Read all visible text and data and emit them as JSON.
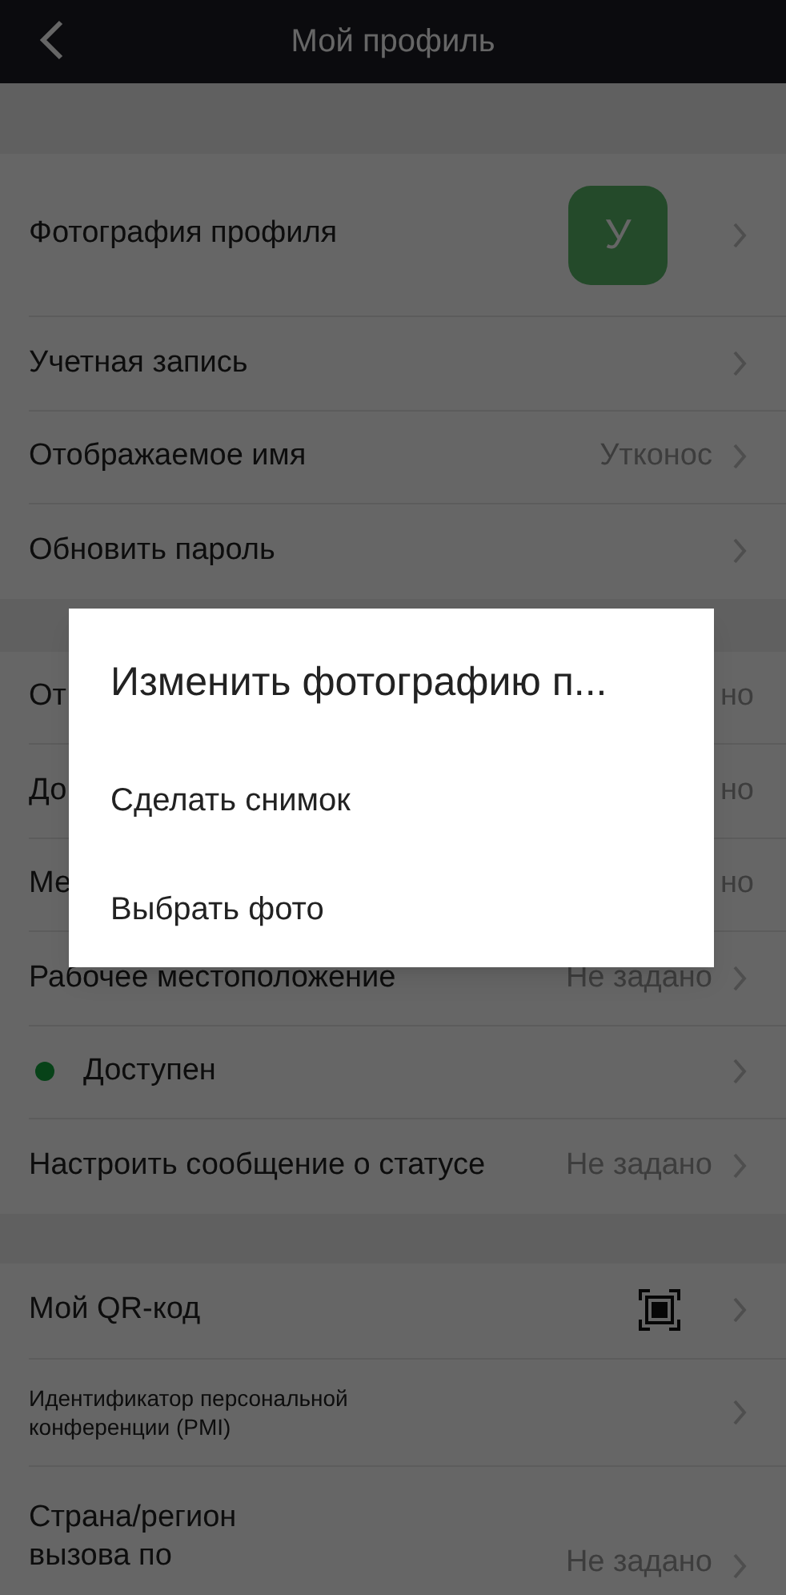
{
  "header": {
    "title": "Мой профиль"
  },
  "sections": [
    [
      {
        "kind": "avatar",
        "label": "Фотография профиля",
        "initial": "У"
      },
      {
        "kind": "plain",
        "label": "Учетная запись"
      },
      {
        "kind": "value",
        "label": "Отображаемое имя",
        "value": "Утконос"
      },
      {
        "kind": "plain",
        "label": "Обновить пароль"
      }
    ],
    [
      {
        "kind": "value",
        "label": "От",
        "value": "но",
        "chevron": false
      },
      {
        "kind": "value",
        "label": "До",
        "value": "но",
        "chevron": false
      },
      {
        "kind": "value",
        "label": "Ме",
        "value": "но",
        "chevron": false
      },
      {
        "kind": "value",
        "label": "Рабочее местоположение",
        "value": "Не задано"
      },
      {
        "kind": "status",
        "label": "Доступен"
      },
      {
        "kind": "value",
        "label": "Настроить сообщение о статусе",
        "value": "Не задано"
      }
    ],
    [
      {
        "kind": "qr",
        "label": "Мой QR-код"
      },
      {
        "kind": "small",
        "label": "Идентификатор персональной конференции (PMI)"
      },
      {
        "kind": "value",
        "label": "Страна/регион вызова по",
        "value": "Не задано"
      }
    ]
  ],
  "dialog": {
    "title": "Изменить фотографию п...",
    "options": [
      "Сделать снимок",
      "Выбрать фото"
    ]
  }
}
